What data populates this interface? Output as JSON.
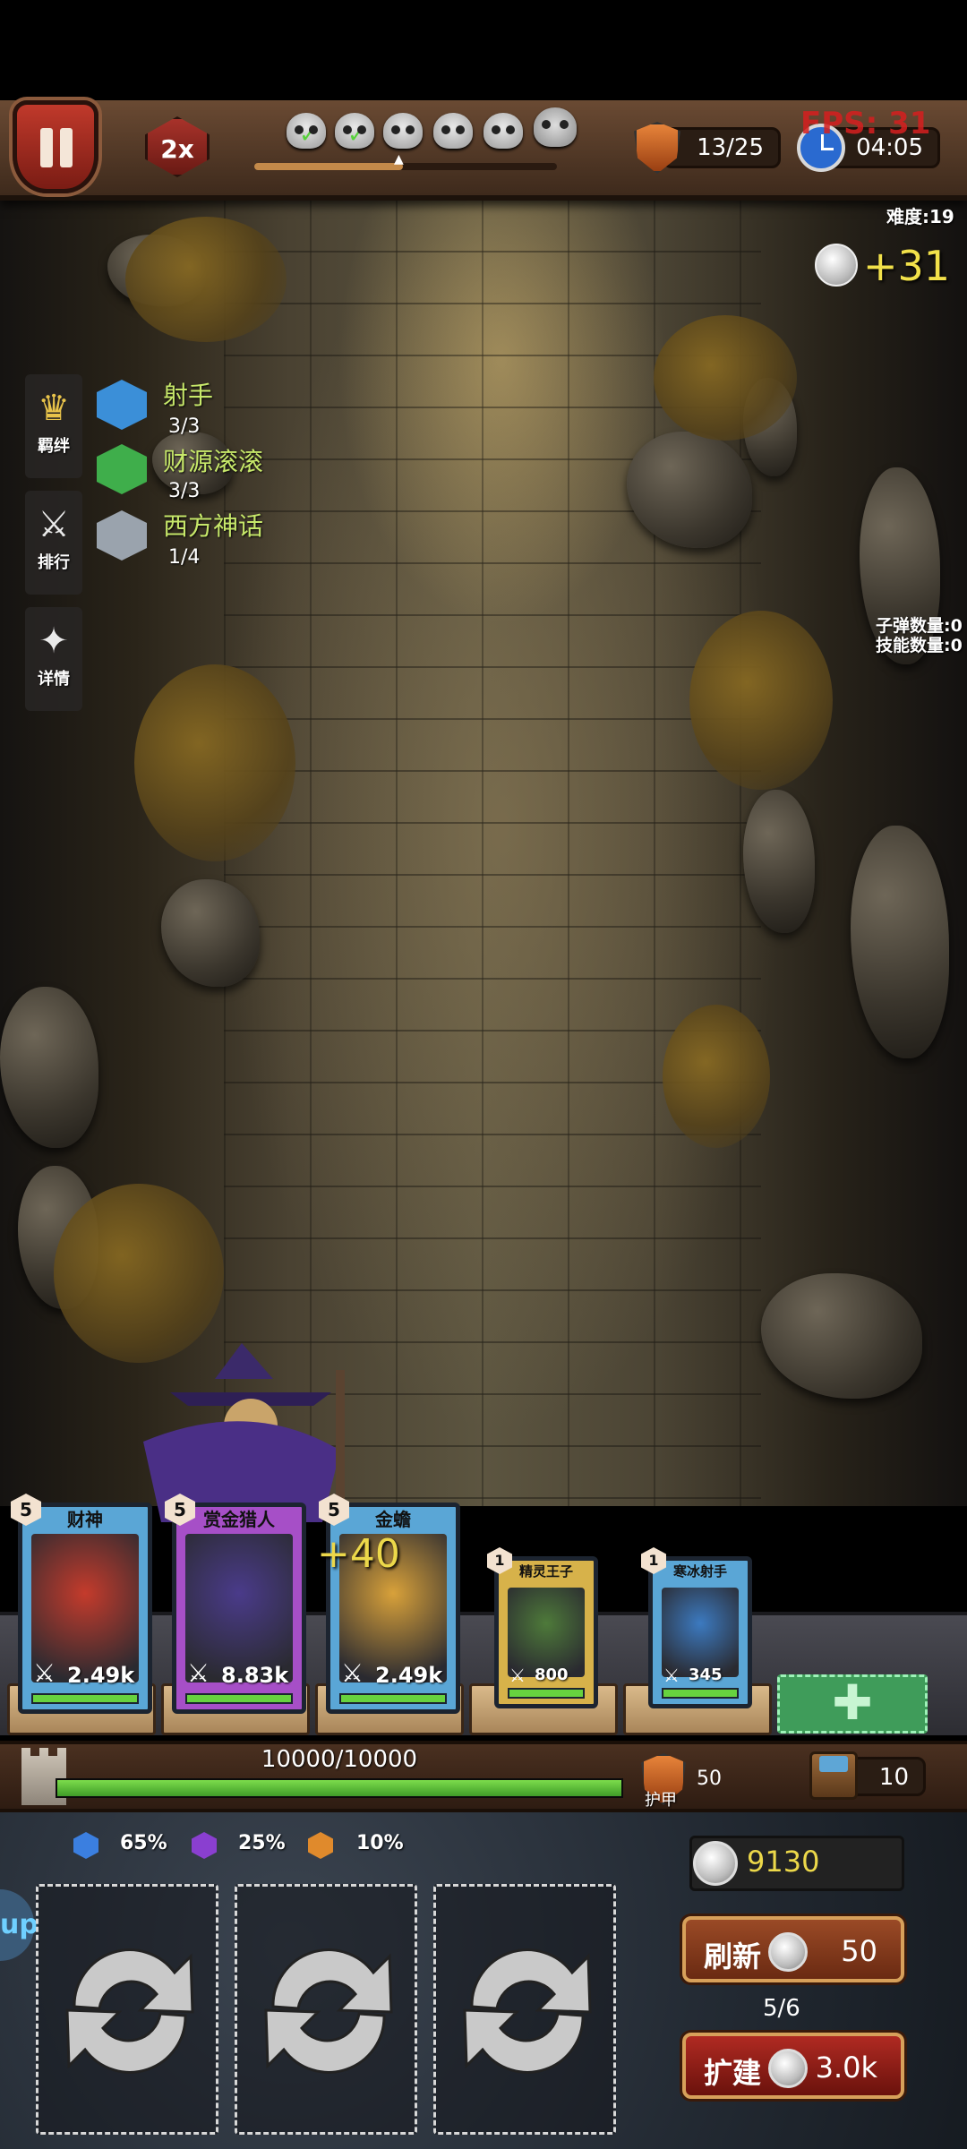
{
  "top_bar": {
    "speed_label": "2x",
    "waves": [
      {
        "state": "cleared",
        "icon": "skull-icon"
      },
      {
        "state": "cleared",
        "icon": "skull-icon"
      },
      {
        "state": "pending",
        "icon": "skull-icon"
      },
      {
        "state": "pending",
        "icon": "skull-icon"
      },
      {
        "state": "pending",
        "icon": "skull-icon"
      },
      {
        "state": "boss",
        "icon": "horned-skull-icon"
      }
    ],
    "wave_progress": 0.49,
    "population": "13/25",
    "timer": "04:05",
    "fps": "FPS: 31"
  },
  "difficulty": "难度:19",
  "coin_gain": "+31",
  "side_menu": [
    {
      "label": "羁绊",
      "icon": "crown-icon"
    },
    {
      "label": "排行",
      "icon": "sword-icon"
    },
    {
      "label": "详情",
      "icon": "wand-icon"
    }
  ],
  "traits": [
    {
      "name": "射手",
      "count": "3/3",
      "color": "#3b8fd8"
    },
    {
      "name": "财源滚滚",
      "count": "3/3",
      "color": "#3fae4b"
    },
    {
      "name": "西方神话",
      "count": "1/4",
      "color": "#9aa3ad"
    }
  ],
  "counters": {
    "bullets": "子弹数量:0",
    "skills": "技能数量:0"
  },
  "float_text": "+40",
  "cards": [
    {
      "name": "财神",
      "level": "5",
      "atk": "2.49k",
      "frame": "#5aa6d6",
      "art": "#c43b2c"
    },
    {
      "name": "赏金猎人",
      "level": "5",
      "atk": "8.83k",
      "frame": "#a64fc7",
      "art": "#4a3b8a"
    },
    {
      "name": "金蟾",
      "level": "5",
      "atk": "2.49k",
      "frame": "#5aa6d6",
      "art": "#d8a13a"
    },
    {
      "name": "精灵王子",
      "level": "1",
      "atk": "800",
      "frame": "#d7b24a",
      "art": "#4e7a3a"
    },
    {
      "name": "寒冰射手",
      "level": "1",
      "atk": "345",
      "frame": "#5aa6d6",
      "art": "#3c7ac0"
    }
  ],
  "base": {
    "hp_text": "10000/10000",
    "hp_fraction": 1.0,
    "armor_label": "护甲",
    "armor_value": "50",
    "chest_count": "10"
  },
  "odds": [
    {
      "value": "65%",
      "color": "#3b7fe0"
    },
    {
      "value": "25%",
      "color": "#8a3fd0"
    },
    {
      "value": "10%",
      "color": "#e08a2c"
    }
  ],
  "shop": {
    "gold": "9130",
    "refresh_label": "刷新",
    "refresh_cost": "50",
    "refresh_count": "5/6",
    "expand_label": "扩建",
    "expand_cost": "3.0k",
    "side_tab": "up"
  }
}
